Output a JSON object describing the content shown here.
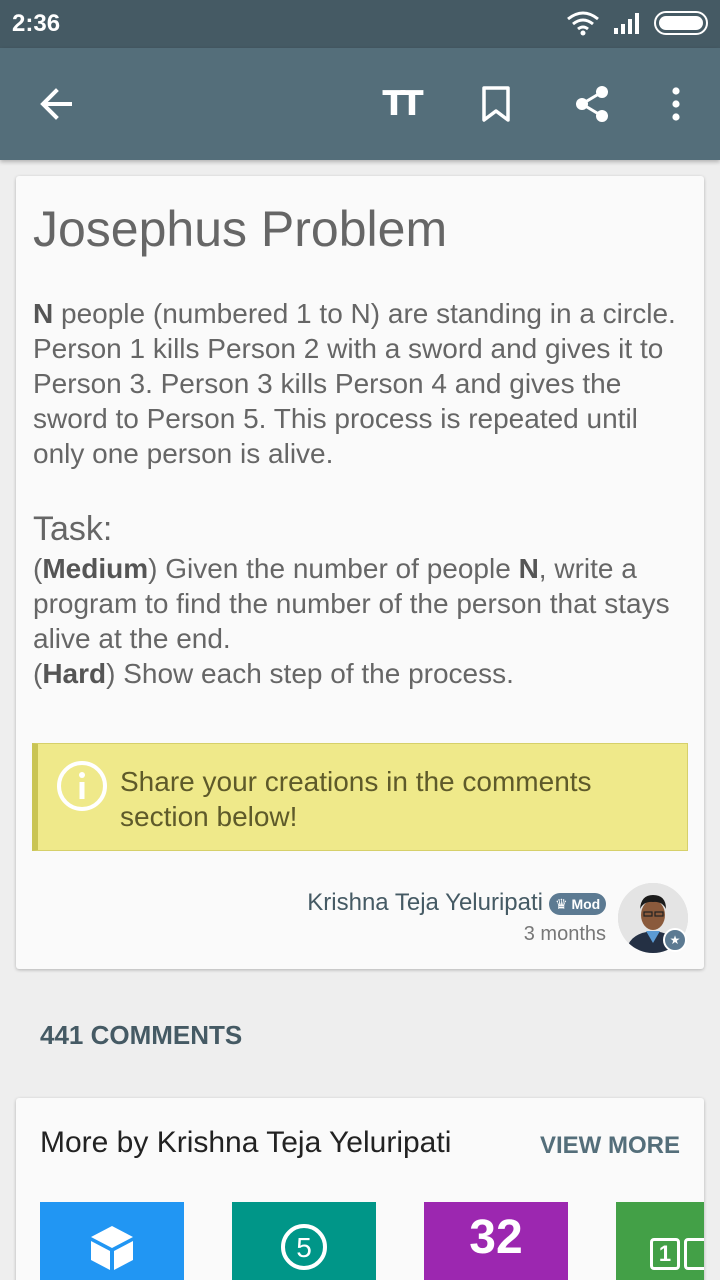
{
  "status_bar": {
    "time": "2:36",
    "wifi_icon": "wifi-icon",
    "signal_icon": "signal-icon",
    "battery_icon": "battery-icon"
  },
  "app_bar": {
    "back_icon": "arrow-back-icon",
    "text_size_icon": "text-size-icon",
    "bookmark_icon": "bookmark-icon",
    "share_icon": "share-icon",
    "more_icon": "more-vert-icon",
    "text_size_glyph": "TT"
  },
  "post": {
    "title": "Josephus Problem",
    "intro_bold": "N",
    "intro_rest": " people (numbered 1 to N) are standing in a circle. Person 1 kills Person 2 with a sword and gives it to Person 3. Person 3 kills Person 4 and gives the sword to Person 5. This process is repeated until only one person is alive.",
    "task_heading": "Task:",
    "task_line1_open": "(",
    "task_line1_level": "Medium",
    "task_line1_mid": ") Given the number of people ",
    "task_line1_bold_n": "N",
    "task_line1_rest": ", write a program to find the number of the person that stays alive at the end.",
    "task_line2_open": "(",
    "task_line2_level": "Hard",
    "task_line2_rest": ") Show each step of the process.",
    "note_text": "Share your creations in the comments section below!",
    "note_icon": "info-icon",
    "author_name": "Krishna Teja Yeluripati",
    "mod_badge": "Mod",
    "time_ago": "3 months"
  },
  "comments": {
    "count_label": "441 COMMENTS"
  },
  "more_by": {
    "title": "More by Krishna Teja Yeluripati",
    "view_more": "VIEW MORE",
    "tiles": [
      {
        "color": "#2196f3",
        "icon": "cube-icon"
      },
      {
        "color": "#009688",
        "icon": "number-five-icon",
        "glyph": "5"
      },
      {
        "color": "#9c27b0",
        "icon": "numbers-icon",
        "glyph": "32"
      },
      {
        "color": "#43a047",
        "icon": "number-grid-icon",
        "glyph": "1"
      }
    ]
  },
  "colors": {
    "status_bar": "#455a64",
    "app_bar": "#546e7a",
    "note_background": "#efe98a",
    "accent": "#546e7a"
  }
}
